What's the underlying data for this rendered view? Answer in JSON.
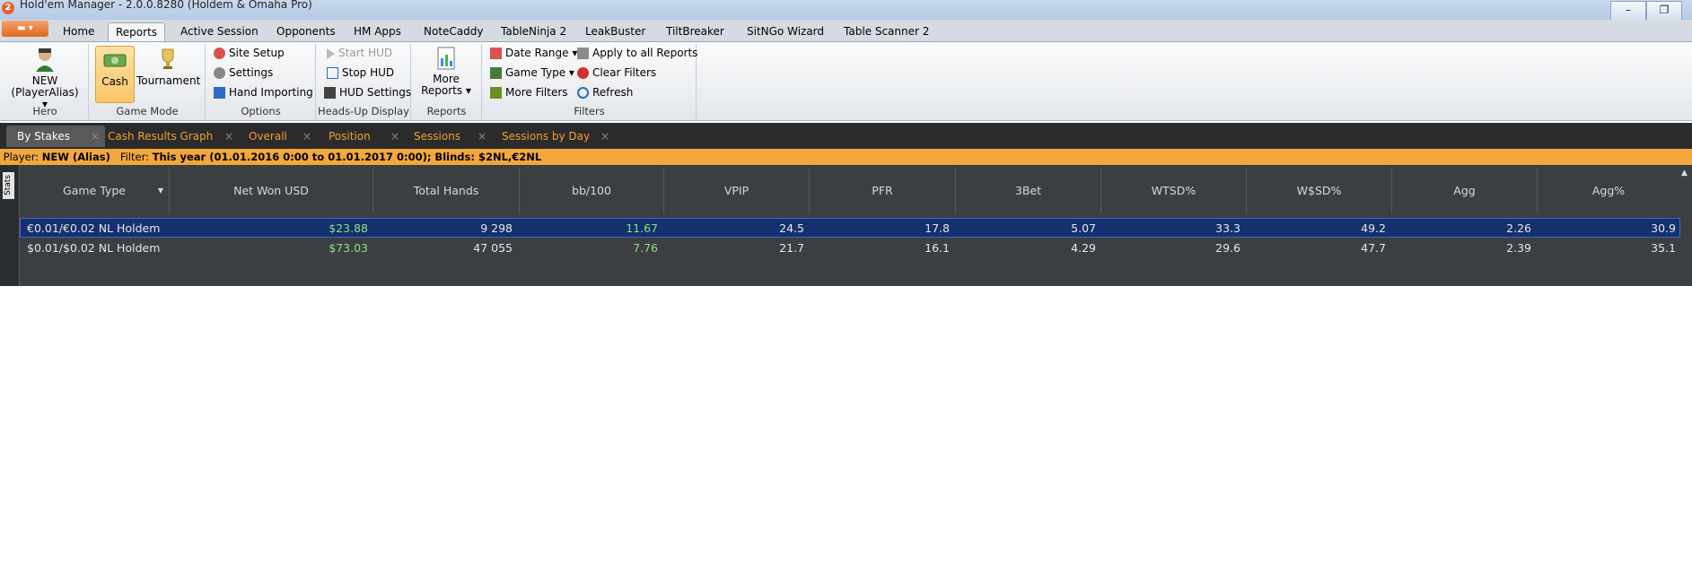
{
  "window": {
    "title": "Hold'em Manager - 2.0.0.8280 (Holdem & Omaha Pro)",
    "app_icon": "2",
    "minimize": "–",
    "restore": "❐"
  },
  "menu": {
    "app_button": "▾",
    "tabs": [
      "Home",
      "Reports",
      "Active Session",
      "Opponents",
      "HM Apps",
      "NoteCaddy",
      "TableNinja 2",
      "LeakBuster",
      "TiltBreaker",
      "SitNGo Wizard",
      "Table Scanner 2"
    ],
    "active": "Reports"
  },
  "ribbon": {
    "hero": {
      "label1": "NEW",
      "label2": "(PlayerAlias) ▾",
      "group": "Hero"
    },
    "game_mode": {
      "cash": "Cash",
      "tournament": "Tournament",
      "group": "Game Mode"
    },
    "options": {
      "site_setup": "Site Setup",
      "settings": "Settings",
      "hand_importing": "Hand Importing",
      "group": "Options"
    },
    "hud": {
      "start": "Start HUD",
      "stop": "Stop HUD",
      "settings": "HUD Settings",
      "group": "Heads-Up Display"
    },
    "reports": {
      "line1": "More",
      "line2": "Reports ▾",
      "group": "Reports"
    },
    "filters": {
      "date_range": "Date Range ▾",
      "game_type": "Game Type ▾",
      "more_filters": "More Filters",
      "apply_all": "Apply to all Reports",
      "clear": "Clear Filters",
      "refresh": "Refresh",
      "group": "Filters"
    }
  },
  "report_tabs": [
    {
      "label": "By Stakes",
      "close": "×"
    },
    {
      "label": "Cash Results Graph",
      "close": "×"
    },
    {
      "label": "Overall",
      "close": "×"
    },
    {
      "label": "Position",
      "close": "×"
    },
    {
      "label": "Sessions",
      "close": "×"
    },
    {
      "label": "Sessions by Day",
      "close": "×"
    }
  ],
  "filter_bar": {
    "player_label": "Player:",
    "player_value": "NEW (Alias)",
    "filter_label": "Filter:",
    "filter_value": "This year (01.01.2016 0:00 to 01.01.2017 0:00); Blinds: $2NL,€2NL"
  },
  "grid": {
    "side_label": "Stats",
    "sort_indicator": "▼",
    "scroll_up": "▲",
    "columns": [
      "Game Type",
      "Net Won USD",
      "Total Hands",
      "bb/100",
      "VPIP",
      "PFR",
      "3Bet",
      "WTSD%",
      "W$SD%",
      "Agg",
      "Agg%"
    ],
    "rows": [
      [
        "€0.01/€0.02 NL Holdem",
        "$23.88",
        "9 298",
        "11.67",
        "24.5",
        "17.8",
        "5.07",
        "33.3",
        "49.2",
        "2.26",
        "30.9"
      ],
      [
        "$0.01/$0.02 NL Holdem",
        "$73.03",
        "47 055",
        "7.76",
        "21.7",
        "16.1",
        "4.29",
        "29.6",
        "47.7",
        "2.39",
        "35.1"
      ]
    ]
  },
  "colors": {
    "accent_orange": "#f2a73c",
    "selected_row": "#14306e",
    "positive_value": "#8fe07a"
  }
}
